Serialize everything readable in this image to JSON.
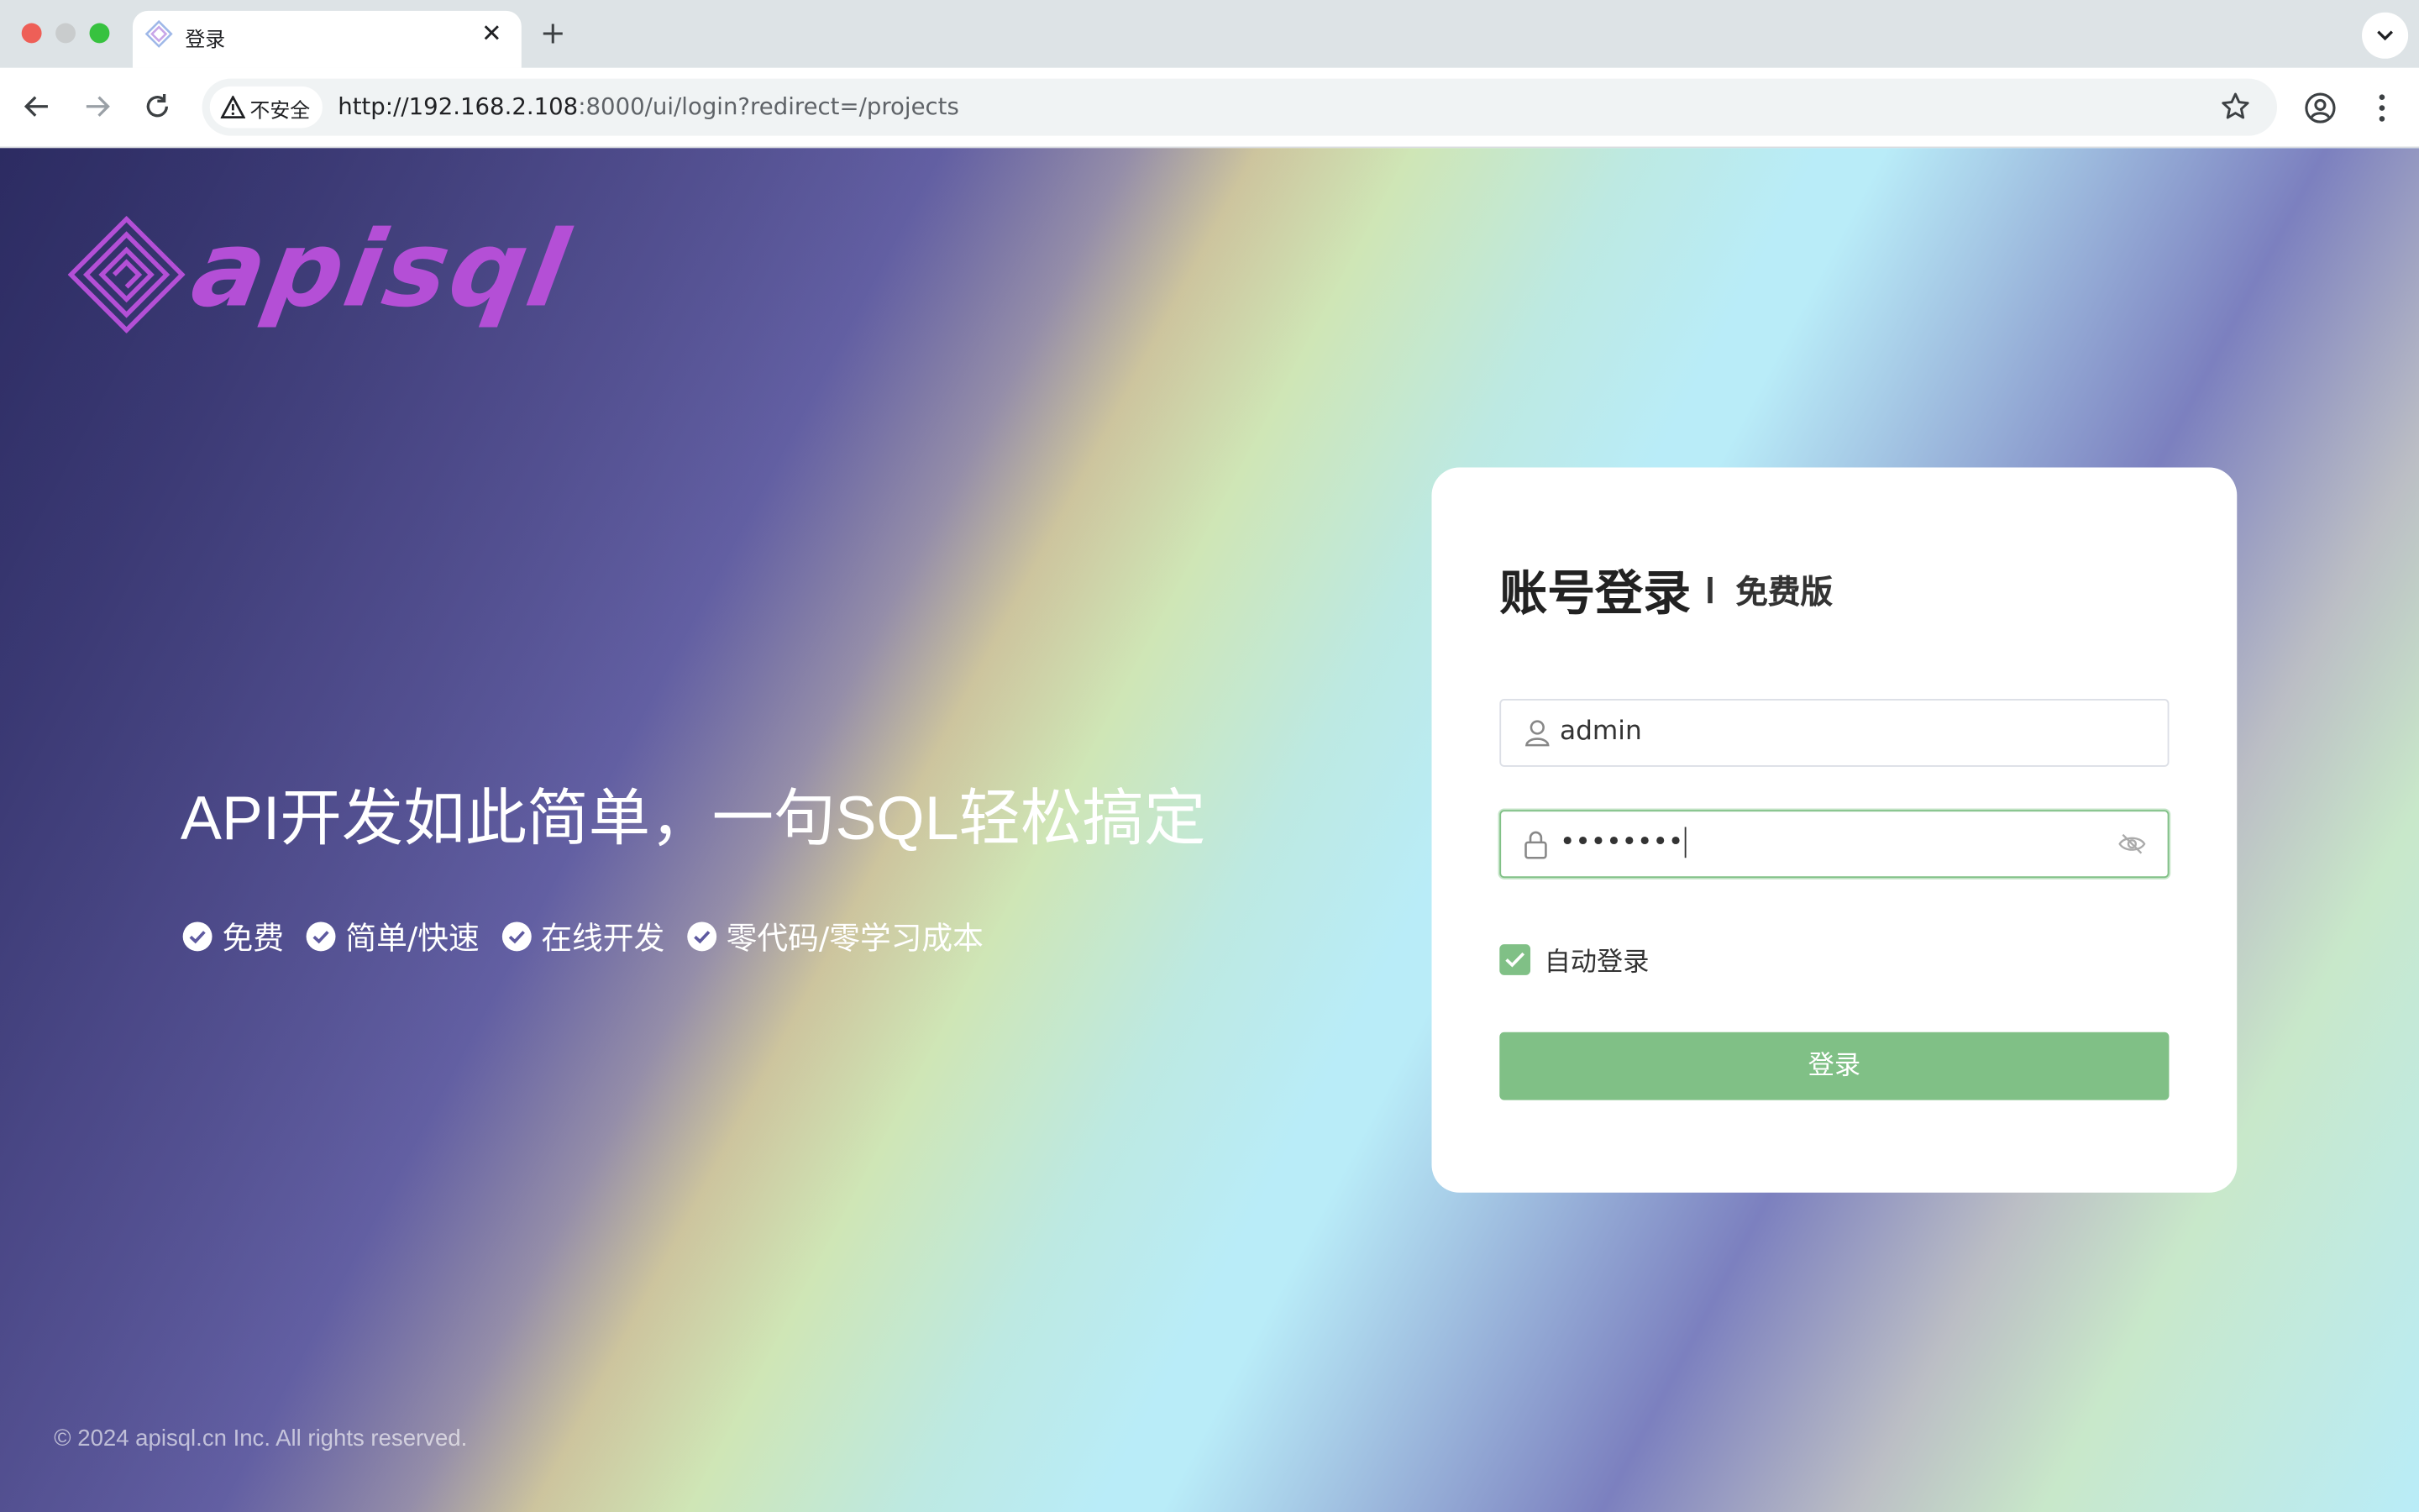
{
  "browser": {
    "tab_title": "登录",
    "new_tab": "+",
    "tab_close": "✕",
    "security_label": "不安全",
    "url_scheme_host": "http://192.168.2.108",
    "url_rest": ":8000/ui/login?redirect=/projects"
  },
  "brand": {
    "logo_text": "apisql",
    "accent_color": "#b44fd6"
  },
  "hero": {
    "slogan": "API开发如此简单，一句SQL轻松搞定",
    "features": [
      "免费",
      "简单/快速",
      "在线开发",
      "零代码/零学习成本"
    ]
  },
  "login": {
    "title": "账号登录",
    "edition": "免费版",
    "username_value": "admin",
    "password_value": "••••••••",
    "remember_label": "自动登录",
    "remember_checked": true,
    "submit_label": "登录",
    "primary_color": "#80c086"
  },
  "footer": {
    "copyright": "© 2024 apisql.cn Inc. All rights reserved."
  }
}
